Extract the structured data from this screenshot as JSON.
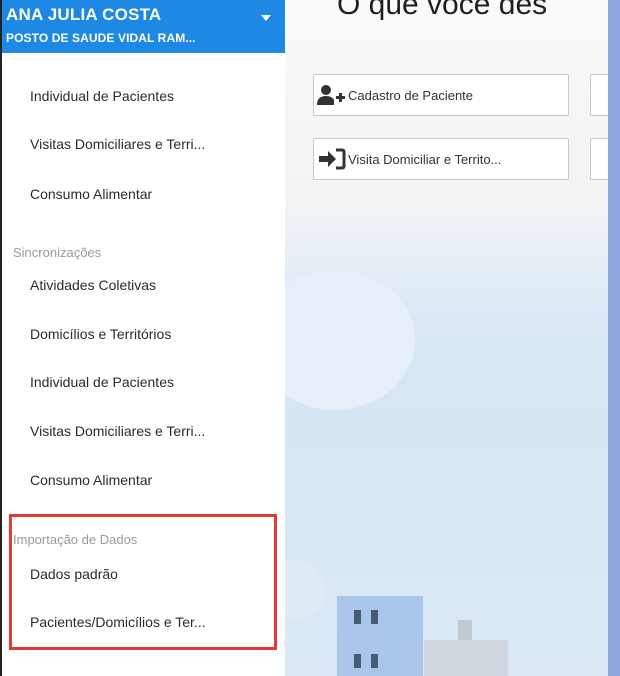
{
  "header": {
    "user_name": "ANA JULIA COSTA",
    "unit_name": "POSTO DE SAUDE VIDAL RAM..."
  },
  "sidebar": {
    "items_top": [
      {
        "label": "Individual de Pacientes"
      },
      {
        "label": "Visitas Domiciliares e Terri..."
      },
      {
        "label": "Consumo Alimentar"
      }
    ],
    "sync_section": {
      "title": "Sincronizações",
      "items": [
        {
          "label": "Atividades Coletivas"
        },
        {
          "label": "Domicílios e Territórios"
        },
        {
          "label": "Individual de Pacientes"
        },
        {
          "label": "Visitas Domiciliares e Terri..."
        },
        {
          "label": "Consumo Alimentar"
        }
      ]
    },
    "import_section": {
      "title": "Importação de Dados",
      "items": [
        {
          "label": "Dados padrão"
        },
        {
          "label": "Pacientes/Domicílios e Ter..."
        }
      ]
    }
  },
  "main": {
    "title": "O que você des",
    "buttons": [
      {
        "label": "Cadastro de Paciente",
        "icon": "add-user-icon"
      },
      {
        "label": "Visita Domiciliar e Territo...",
        "icon": "sign-in-icon"
      }
    ]
  },
  "colors": {
    "header_bg": "#1e88e5",
    "highlight": "#e53935",
    "right_bar": "#8ea7dd"
  }
}
